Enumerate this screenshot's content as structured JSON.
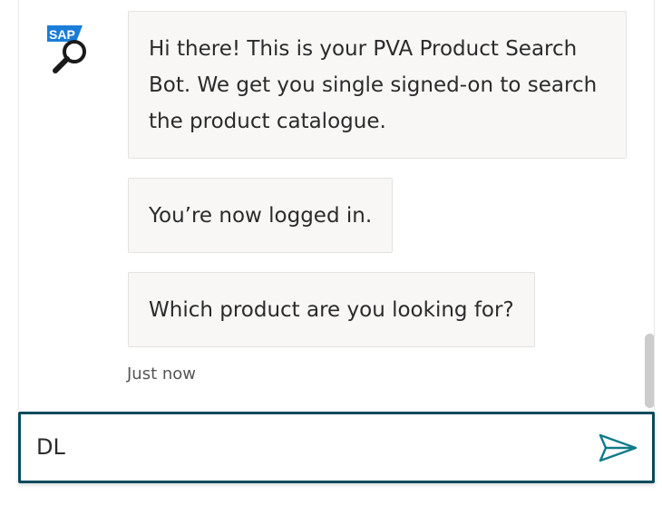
{
  "bot": {
    "avatar_icon": "sap-search-bot-icon",
    "avatar_text": "SAP"
  },
  "messages": [
    {
      "text": "Hi there! This is your PVA Product Search Bot. We get you single signed-on to search the product catalogue."
    },
    {
      "text": "You’re now logged in."
    },
    {
      "text": "Which product are you looking for?"
    }
  ],
  "timestamp": "Just now",
  "composer": {
    "value": "DL",
    "send_icon": "send-icon"
  },
  "colors": {
    "accent": "#0a4a5c",
    "sap_blue": "#1a7dd8",
    "bubble_bg": "#f8f7f6",
    "send_icon": "#0f7c8a"
  }
}
